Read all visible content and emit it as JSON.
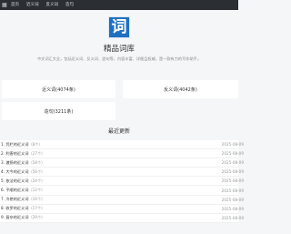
{
  "topbar": {
    "logo_icon": "book-icon",
    "nav": [
      "首页",
      "近义词",
      "反义词",
      "造句"
    ]
  },
  "hero": {
    "logo_char": "词",
    "site_name": "精品词库",
    "description": "中文词汇大全，包括近义词、反义词、造句等，内容丰富、详细且权威，是一款有力的写作助手。"
  },
  "categories": [
    {
      "label": "近义词(4074条)"
    },
    {
      "label": "反义词(4042条)"
    },
    {
      "label": "造句(3211条)"
    }
  ],
  "recent": {
    "title": "最近更新",
    "items": [
      {
        "title": "1. 凭栏的近义词",
        "count": "（8个）",
        "date": "2025-08-09"
      },
      {
        "title": "2. 利害的近义词",
        "count": "（27个）",
        "date": "2025-08-09"
      },
      {
        "title": "3. 激扬的近义词",
        "count": "（18个）",
        "date": "2025-08-09"
      },
      {
        "title": "4. 大今的近义词",
        "count": "（56个）",
        "date": "2025-08-09"
      },
      {
        "title": "5. 依法的近义词",
        "count": "（24个）",
        "date": "2025-08-09"
      },
      {
        "title": "6. 平顺的近义词",
        "count": "（12个）",
        "date": "2025-08-09"
      },
      {
        "title": "7. 冷艳的近义词",
        "count": "（16个）",
        "date": "2025-08-09"
      },
      {
        "title": "8. 收罗的近义词",
        "count": "（17个）",
        "date": "2025-08-09"
      },
      {
        "title": "9. 复杂的近义词",
        "count": "（29个）",
        "date": "2025-08-09"
      }
    ]
  }
}
